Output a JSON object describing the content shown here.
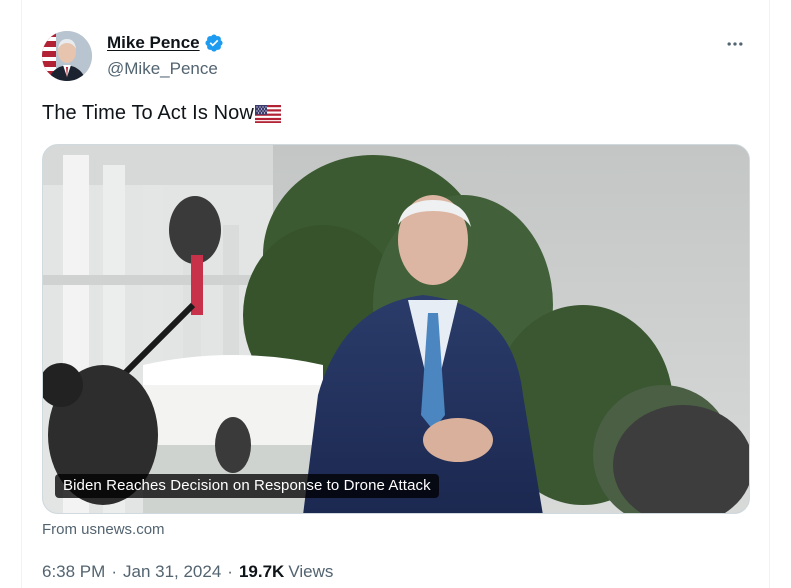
{
  "author": {
    "name": "Mike Pence",
    "handle": "@Mike_Pence",
    "verified": true
  },
  "tweet": {
    "text": "The Time To Act Is Now",
    "emoji": "us-flag-icon"
  },
  "media": {
    "caption": "Biden Reaches Decision on Response to Drone Attack",
    "source": "From usnews.com"
  },
  "meta": {
    "time": "6:38 PM",
    "separator": "·",
    "date": "Jan 31, 2024",
    "views_count": "19.7K",
    "views_label": "Views"
  },
  "icons": {
    "more": "more-horizontal-icon",
    "verified": "verified-badge-icon"
  },
  "colors": {
    "verified_blue": "#1d9bf0",
    "secondary_text": "#536471",
    "primary_text": "#0f1419"
  }
}
